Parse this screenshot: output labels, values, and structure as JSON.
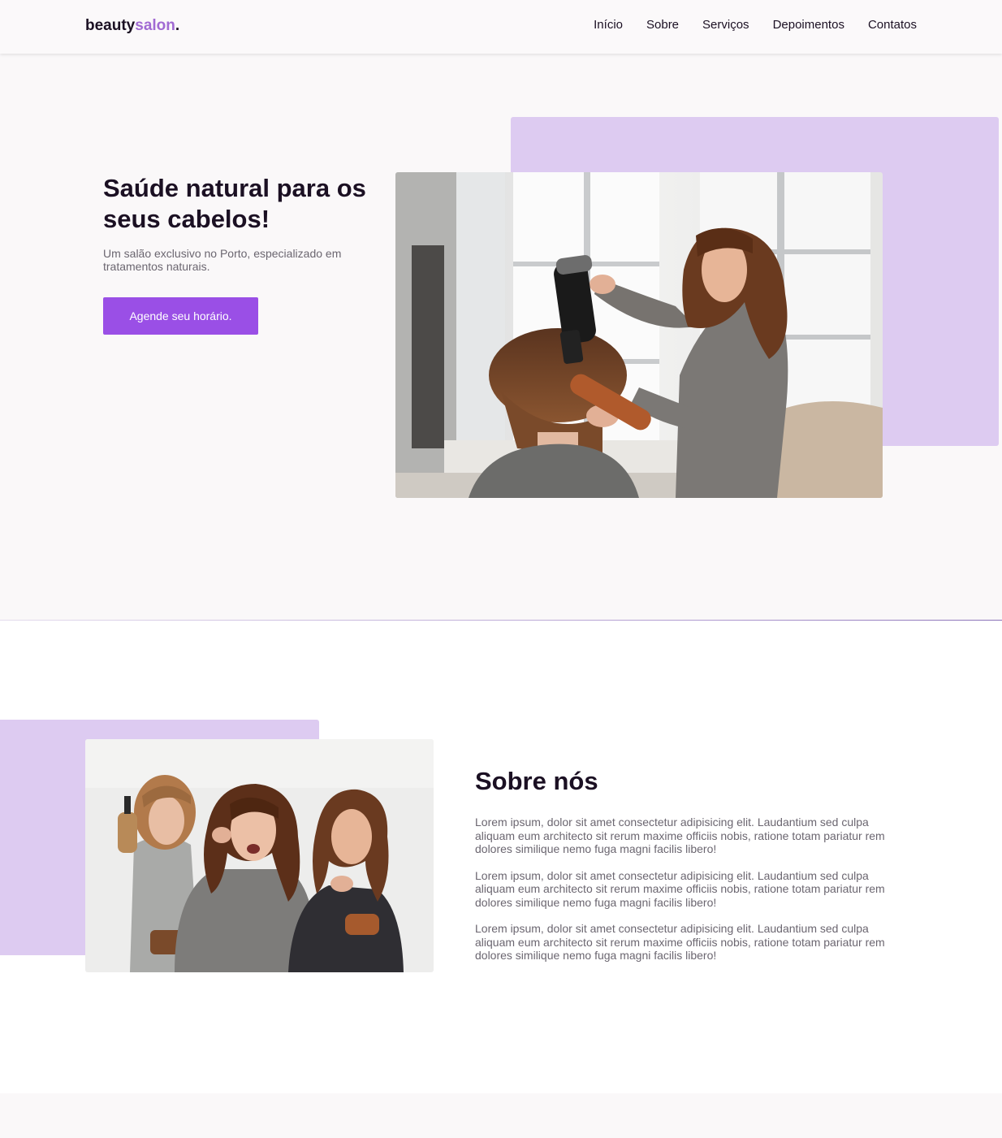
{
  "header": {
    "logo_main": "beauty",
    "logo_accent": "salon",
    "logo_dot": ".",
    "nav": [
      "Início",
      "Sobre",
      "Serviços",
      "Depoimentos",
      "Contatos"
    ]
  },
  "hero": {
    "title": "Saúde natural para os seus cabelos!",
    "subtitle": "Um salão exclusivo no Porto, especializado em tratamentos naturais.",
    "cta_label": "Agende seu horário."
  },
  "about": {
    "title": "Sobre nós",
    "paragraphs": [
      "Lorem ipsum, dolor sit amet consectetur adipisicing elit. Laudantium sed culpa aliquam eum architecto sit rerum maxime officiis nobis, ratione totam pariatur rem dolores similique nemo fuga magni facilis libero!",
      "Lorem ipsum, dolor sit amet consectetur adipisicing elit. Laudantium sed culpa aliquam eum architecto sit rerum maxime officiis nobis, ratione totam pariatur rem dolores similique nemo fuga magni facilis libero!",
      "Lorem ipsum, dolor sit amet consectetur adipisicing elit. Laudantium sed culpa aliquam eum architecto sit rerum maxime officiis nobis, ratione totam pariatur rem dolores similique nemo fuga magni facilis libero!"
    ]
  },
  "colors": {
    "accent": "#a16ad3",
    "button": "#9a4fe6",
    "lavender": "#ddcbf1",
    "text_dark": "#1b1023",
    "text_muted": "#6b6670"
  }
}
